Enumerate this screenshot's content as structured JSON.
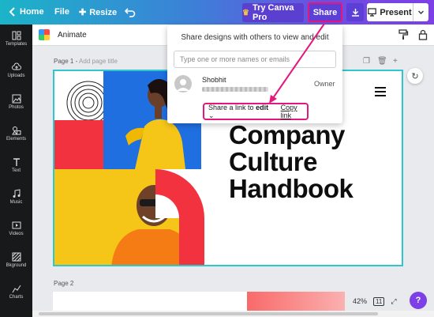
{
  "topbar": {
    "home": "Home",
    "file": "File",
    "resize": "Resize",
    "try_pro": "Try Canva Pro",
    "share": "Share",
    "present": "Present"
  },
  "sidebar": {
    "items": [
      {
        "label": "Templates",
        "icon": "grid-icon"
      },
      {
        "label": "Uploads",
        "icon": "cloud-upload-icon"
      },
      {
        "label": "Photos",
        "icon": "image-icon"
      },
      {
        "label": "Elements",
        "icon": "shapes-icon"
      },
      {
        "label": "Text",
        "icon": "text-icon"
      },
      {
        "label": "Music",
        "icon": "music-icon"
      },
      {
        "label": "Videos",
        "icon": "video-icon"
      },
      {
        "label": "Bkground",
        "icon": "background-icon"
      },
      {
        "label": "Charts",
        "icon": "chart-icon"
      }
    ]
  },
  "toolbar2": {
    "animate": "Animate"
  },
  "page1": {
    "label": "Page 1 -",
    "title_placeholder": "Add page title",
    "headline_lines": [
      "Company",
      "Culture",
      "Handbook"
    ]
  },
  "page2": {
    "label": "Page 2"
  },
  "status": {
    "zoom": "42%",
    "page_count": "11",
    "help": "?"
  },
  "share_popup": {
    "title": "Share designs with others to view and edit",
    "input_placeholder": "Type one or more names or emails",
    "user_name": "Shobhit",
    "user_role": "Owner",
    "link_prefix": "Share a link to",
    "link_permission": "edit",
    "copy_link": "Copy link"
  },
  "colors": {
    "accent": "#e4177c",
    "brand_purple": "#7d3fe6",
    "page_border": "#2fc7cf",
    "red": "#f2323f",
    "blue": "#1f6fe0",
    "yellow": "#f5c518"
  }
}
